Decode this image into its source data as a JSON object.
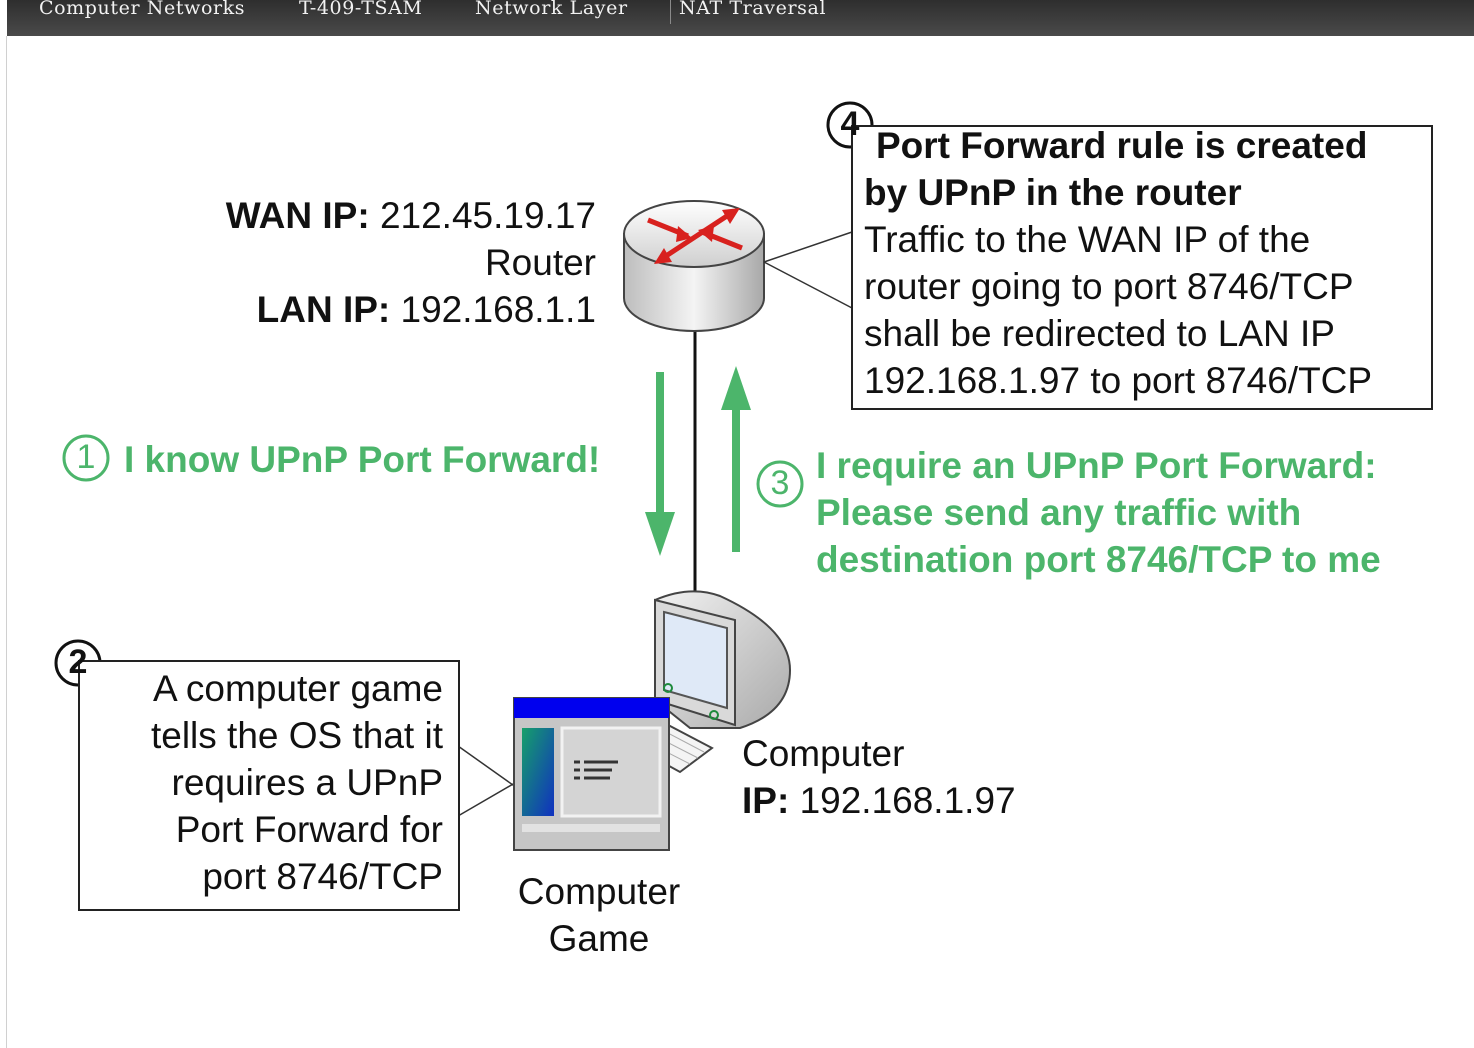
{
  "header": {
    "course": "Computer Networks",
    "code": "T-409-TSAM",
    "section": "Network Layer",
    "topic": "NAT Traversal"
  },
  "router": {
    "wan_label": "WAN IP:",
    "wan_ip": "212.45.19.17",
    "name": "Router",
    "lan_label": "LAN IP:",
    "lan_ip": "192.168.1.1"
  },
  "computer": {
    "name": "Computer",
    "ip_label": "IP:",
    "ip": "192.168.1.97"
  },
  "game": {
    "line1": "Computer",
    "line2": "Game"
  },
  "steps": {
    "s1": {
      "num": "1",
      "text": "I know UPnP Port Forward!"
    },
    "s2": {
      "num": "2",
      "lines": [
        "A computer game",
        "tells the OS that it",
        "requires a UPnP",
        "Port Forward for",
        "port 8746/TCP"
      ]
    },
    "s3": {
      "num": "3",
      "lines": [
        "I require an UPnP Port Forward:",
        "Please send any traffic with",
        "destination port 8746/TCP to me"
      ]
    },
    "s4": {
      "num": "4",
      "title_lines": [
        "Port Forward rule is created",
        "by UPnP in the router"
      ],
      "lines": [
        "Traffic to the WAN IP of the",
        "router going to port 8746/TCP",
        "shall be redirected to LAN IP",
        "192.168.1.97 to port 8746/TCP"
      ]
    }
  },
  "colors": {
    "accent_green": "#4cb56b",
    "router_arrows": "#e02020",
    "window_title": "#0000ee"
  }
}
